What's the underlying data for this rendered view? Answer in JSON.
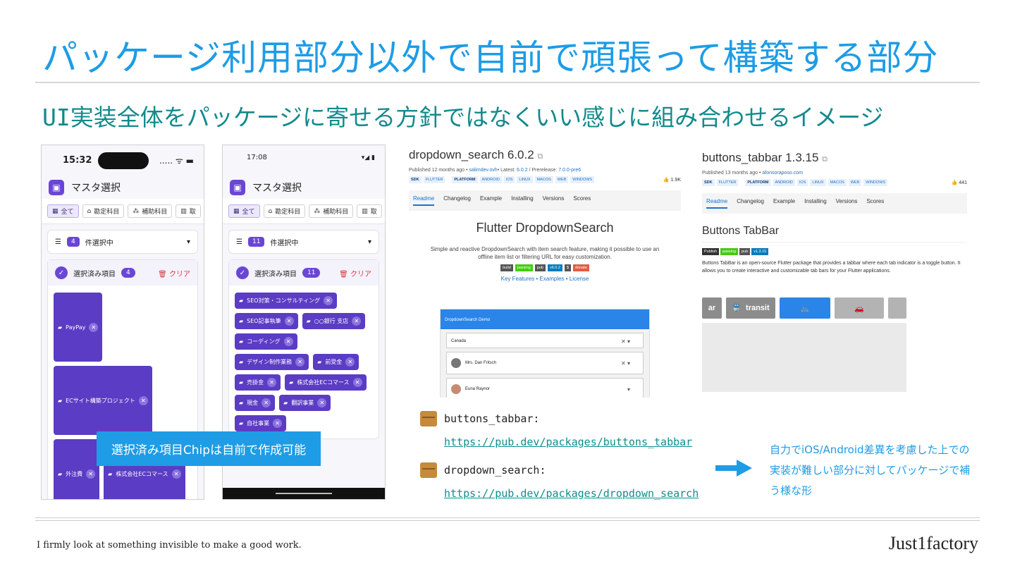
{
  "slide": {
    "title": "パッケージ利用部分以外で自前で頑張って構築する部分",
    "subtitle": "UI実装全体をパッケージに寄せる方針ではなくいい感じに組み合わせるイメージ",
    "callout": "選択済み項目Chipは自前で作成可能",
    "note": "自力でiOS/Android差異を考慮した上での実装が難しい部分に対してパッケージで補う様な形",
    "motto": "I firmly look at something invisible to make a good work.",
    "brand": "Just1factory",
    "accent_color": "#1e9ce6"
  },
  "phone1": {
    "time": "15:32",
    "signal": "..... ᯤ ▬",
    "app_title": "マスタ選択",
    "tabs": [
      "全て",
      "勘定科目",
      "補助科目",
      "取"
    ],
    "selected_count": "4",
    "selected_label": "件選択中",
    "chip_header": "選択済み項目",
    "chip_count": "4",
    "clear": "クリア",
    "chips": [
      "PayPay",
      "ECサイト構築プロジェクト",
      "外注費",
      "株式会社ECコマース"
    ]
  },
  "phone2": {
    "time": "17:08",
    "signal": "▾◢ ▮",
    "app_title": "マスタ選択",
    "tabs": [
      "全て",
      "勘定科目",
      "補助科目",
      "取"
    ],
    "selected_count": "11",
    "selected_label": "件選択中",
    "chip_header": "選択済み項目",
    "chip_count": "11",
    "clear": "クリア",
    "chips": [
      "SEO対策・コンサルティング",
      "SEO記事執筆",
      "○○銀行 支店",
      "コーディング",
      "デザイン制作業務",
      "前受金",
      "売掛金",
      "株式会社ECコマース",
      "現金",
      "翻訳事業",
      "自社事業"
    ]
  },
  "dropdown_pkg": {
    "name": "dropdown_search 6.0.2",
    "published": "Published 12 months ago •",
    "publisher": "salimdev.ovh",
    "latest_label": "• Latest:",
    "latest": "6.0.2",
    "prerelease_label": "/ Prerelease:",
    "prerelease": "7.0.0-pre6",
    "tags": [
      "SDK",
      "FLUTTER",
      "PLATFORM",
      "ANDROID",
      "IOS",
      "LINUX",
      "MACOS",
      "WEB",
      "WINDOWS"
    ],
    "likes": "1.9K",
    "nav": [
      "Readme",
      "Changelog",
      "Example",
      "Installing",
      "Versions",
      "Scores"
    ],
    "readme_title": "Flutter DropdownSearch",
    "readme_text": "Simple and reactive DropdownSearch with item search feature, making it possible to use an offline item list or filtering URL for easy customization.",
    "badges": [
      "build",
      "passing",
      "pub",
      "v6.0.2",
      "$",
      "donate"
    ],
    "links": "Key Features • Examples • License",
    "demo_title": "DropdownSearch Demo",
    "demo_fields": [
      "Canada",
      "Mrs. Dan Fritsch",
      "Euna Raynor"
    ]
  },
  "tabbar_pkg": {
    "name": "buttons_tabbar 1.3.15",
    "published": "Published 13 months ago •",
    "publisher": "afonsoraposo.com",
    "tags": [
      "SDK",
      "FLUTTER",
      "PLATFORM",
      "ANDROID",
      "IOS",
      "LINUX",
      "MACOS",
      "WEB",
      "WINDOWS"
    ],
    "likes": "441",
    "nav": [
      "Readme",
      "Changelog",
      "Example",
      "Installing",
      "Versions",
      "Scores"
    ],
    "readme_title": "Buttons TabBar",
    "badges": [
      "Publish",
      "passing",
      "pub",
      "v1.3.15"
    ],
    "readme_text": "Buttons TabBar is an open-source Flutter package that provides a tabbar where each tab indicator is a toggle button. It allows you to create interactive and customizable tab bars for your Flutter applications.",
    "tab_partial": "ar",
    "tab_transit": "transit"
  },
  "links": {
    "tabbar_label": "buttons_tabbar:",
    "tabbar_url": "https://pub.dev/packages/buttons_tabbar",
    "dropdown_label": "dropdown_search:",
    "dropdown_url": "https://pub.dev/packages/dropdown_search"
  }
}
